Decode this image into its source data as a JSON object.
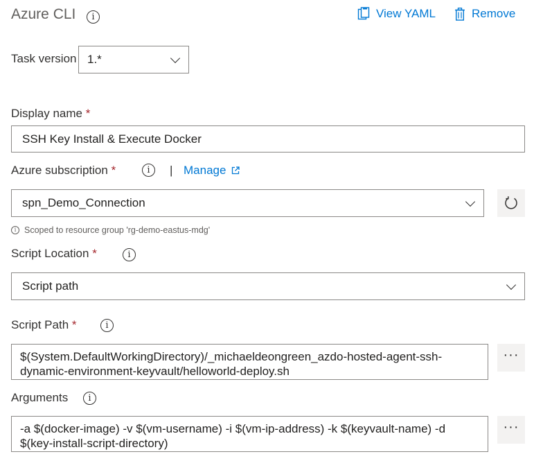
{
  "header": {
    "title": "Azure CLI",
    "view_yaml": "View YAML",
    "remove": "Remove"
  },
  "task_version": {
    "label": "Task version",
    "value": "1.*"
  },
  "display_name": {
    "label": "Display name",
    "required": "*",
    "value": "SSH Key Install & Execute Docker"
  },
  "subscription": {
    "label": "Azure subscription",
    "required": "*",
    "separator": "|",
    "manage": "Manage",
    "value": "spn_Demo_Connection",
    "hint": "Scoped to resource group 'rg-demo-eastus-mdg'"
  },
  "script_location": {
    "label": "Script Location",
    "required": "*",
    "value": "Script path"
  },
  "script_path": {
    "label": "Script Path",
    "required": "*",
    "line1": "$(System.DefaultWorkingDirectory)/_michaeldeongreen_azdo-hosted-agent-ssh-",
    "line2": "dynamic-environment-keyvault/helloworld-deploy.sh",
    "more": "···"
  },
  "arguments": {
    "label": "Arguments",
    "line1": "-a $(docker-image) -v $(vm-username) -i $(vm-ip-address) -k $(keyvault-name) -d",
    "line2": "$(key-install-script-directory)",
    "more": "···"
  },
  "colors": {
    "link": "#0078d4",
    "required": "#a4262c",
    "border": "#8a8886",
    "button_bg": "#f3f2f1"
  },
  "icons": [
    "info-icon",
    "clipboard-icon",
    "trash-icon",
    "external-link-icon",
    "chevron-down-icon",
    "refresh-icon",
    "more-icon"
  ]
}
